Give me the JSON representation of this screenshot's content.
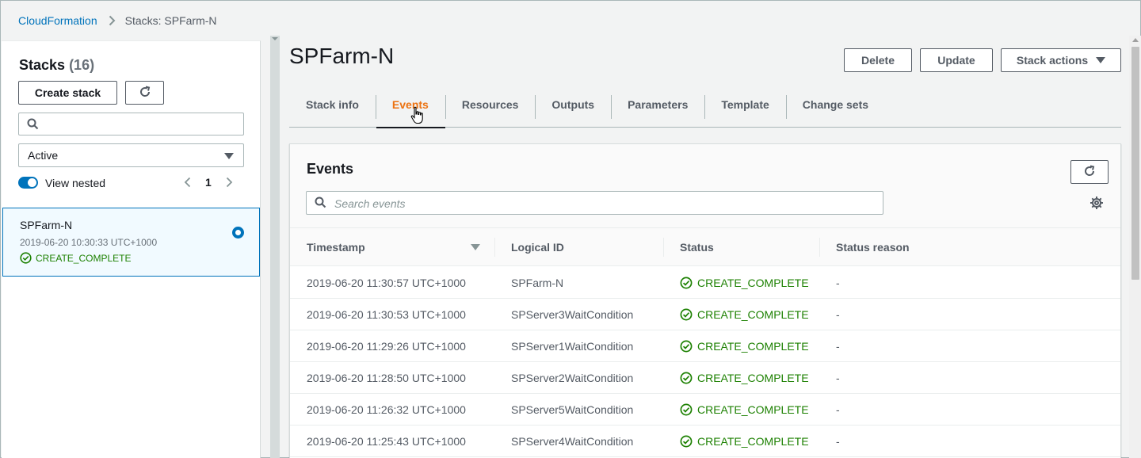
{
  "breadcrumb": {
    "root": "CloudFormation",
    "current": "Stacks: SPFarm-N"
  },
  "left_panel": {
    "title": "Stacks",
    "count": "(16)",
    "create_label": "Create stack",
    "search_placeholder": "",
    "filter_value": "Active",
    "view_nested_label": "View nested",
    "page": "1",
    "selected_stack": {
      "name": "SPFarm-N",
      "date": "2019-06-20 10:30:33 UTC+1000",
      "status": "CREATE_COMPLETE"
    }
  },
  "main": {
    "title": "SPFarm-N",
    "delete_label": "Delete",
    "update_label": "Update",
    "stack_actions_label": "Stack actions",
    "tabs": [
      {
        "label": "Stack info"
      },
      {
        "label": "Events"
      },
      {
        "label": "Resources"
      },
      {
        "label": "Outputs"
      },
      {
        "label": "Parameters"
      },
      {
        "label": "Template"
      },
      {
        "label": "Change sets"
      }
    ],
    "active_tab": "Events"
  },
  "events": {
    "title": "Events",
    "search_placeholder": "Search events",
    "columns": [
      "Timestamp",
      "Logical ID",
      "Status",
      "Status reason"
    ],
    "rows": [
      {
        "timestamp": "2019-06-20 11:30:57 UTC+1000",
        "logical_id": "SPFarm-N",
        "status": "CREATE_COMPLETE",
        "reason": "-"
      },
      {
        "timestamp": "2019-06-20 11:30:53 UTC+1000",
        "logical_id": "SPServer3WaitCondition",
        "status": "CREATE_COMPLETE",
        "reason": "-"
      },
      {
        "timestamp": "2019-06-20 11:29:26 UTC+1000",
        "logical_id": "SPServer1WaitCondition",
        "status": "CREATE_COMPLETE",
        "reason": "-"
      },
      {
        "timestamp": "2019-06-20 11:28:50 UTC+1000",
        "logical_id": "SPServer2WaitCondition",
        "status": "CREATE_COMPLETE",
        "reason": "-"
      },
      {
        "timestamp": "2019-06-20 11:26:32 UTC+1000",
        "logical_id": "SPServer5WaitCondition",
        "status": "CREATE_COMPLETE",
        "reason": "-"
      },
      {
        "timestamp": "2019-06-20 11:25:43 UTC+1000",
        "logical_id": "SPServer4WaitCondition",
        "status": "CREATE_COMPLETE",
        "reason": "-"
      }
    ]
  },
  "colors": {
    "link": "#0073bb",
    "active_tab": "#ec7211",
    "success": "#1d8102",
    "selected_bg": "#f1faff"
  },
  "icons": [
    "chevron-right-icon",
    "refresh-icon",
    "search-icon",
    "caret-down-icon",
    "chevron-left-icon",
    "check-circle-icon",
    "gear-icon",
    "hand-cursor-icon"
  ]
}
